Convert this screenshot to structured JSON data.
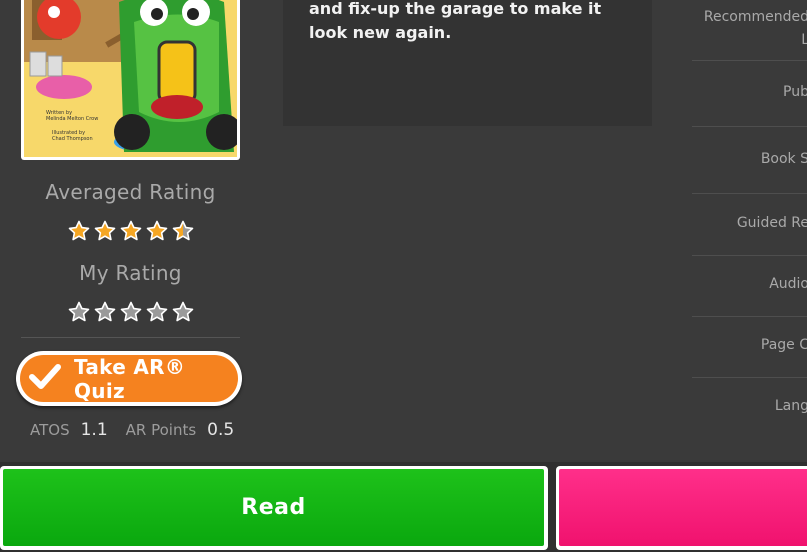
{
  "description": {
    "text": "and fix-up the garage to make it look new again."
  },
  "cover": {
    "written_by": "Written by",
    "author": "Melinda Melton Crow",
    "illustrated_by": "Illustrated by",
    "illustrator": "Chad Thompson"
  },
  "ratings": {
    "averaged_label": "Averaged Rating",
    "averaged_value": 4.5,
    "my_label": "My Rating",
    "my_value": 0
  },
  "quiz": {
    "label": "Take AR® Quiz"
  },
  "meta": {
    "atos_label": "ATOS",
    "atos_value": "1.1",
    "ar_points_label": "AR Points",
    "ar_points_value": "0.5"
  },
  "info_list": [
    {
      "line1": "Recommended",
      "line2": "L"
    },
    {
      "line1": "Pub"
    },
    {
      "line1": "Book S"
    },
    {
      "line1": "Guided Re"
    },
    {
      "line1": "Audio"
    },
    {
      "line1": "Page C"
    },
    {
      "line1": "Lang"
    }
  ],
  "actions": {
    "read_label": "Read"
  },
  "colors": {
    "background": "#3a3a3a",
    "star": "#f5a623",
    "quiz_button": "#f5821f",
    "read_button": "#14b814",
    "pink_button": "#ff2a82"
  }
}
